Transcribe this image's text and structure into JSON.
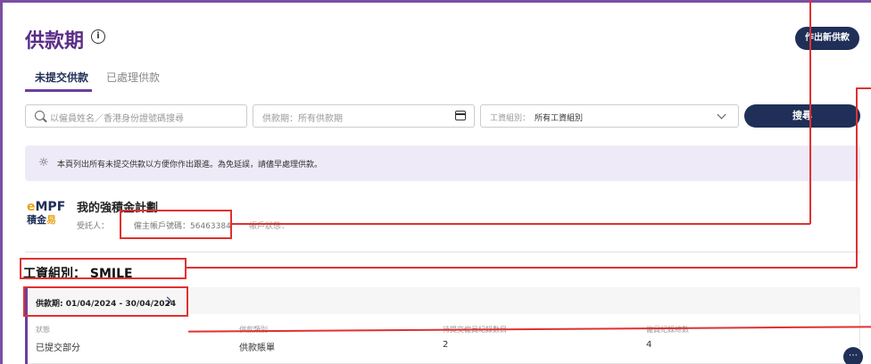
{
  "header": {
    "title": "供款期",
    "new_button": "作出新供款"
  },
  "tabs": [
    {
      "label": "未提交供款",
      "active": true
    },
    {
      "label": "已處理供款",
      "active": false
    }
  ],
  "filters": {
    "search_placeholder": "以僱員姓名／香港身份證號碼搜尋",
    "period_placeholder": "供款期：所有供款期",
    "group_label": "工資組別：",
    "group_value": "所有工資組別",
    "search_button": "搜尋"
  },
  "notice": {
    "text": "本頁列出所有未提交供款以方便你作出跟進。為免延誤，請儘早處理供款。"
  },
  "scheme": {
    "logo_top_prefix": "e",
    "logo_top": "MPF",
    "logo_bottom_a": "積金",
    "logo_bottom_b": "易",
    "name": "我的強積金計劃",
    "trustee_label": "受託人：",
    "employer_account": "僱主帳戶號碼：56463384",
    "account_status": "帳戶狀態："
  },
  "payroll_group": {
    "heading": "工資組別： SMILE"
  },
  "period_card": {
    "header": "供款期: 01/04/2024 - 30/04/2024",
    "columns": [
      "狀態",
      "供款類別",
      "待提交僱員紀錄數目",
      "僱員紀錄總數"
    ],
    "values": [
      "已提交部分",
      "供款賬單",
      "2",
      "4"
    ]
  },
  "colors": {
    "brand_purple": "#5b2d86",
    "navy": "#1f2f57",
    "annotation_red": "#e03131"
  }
}
